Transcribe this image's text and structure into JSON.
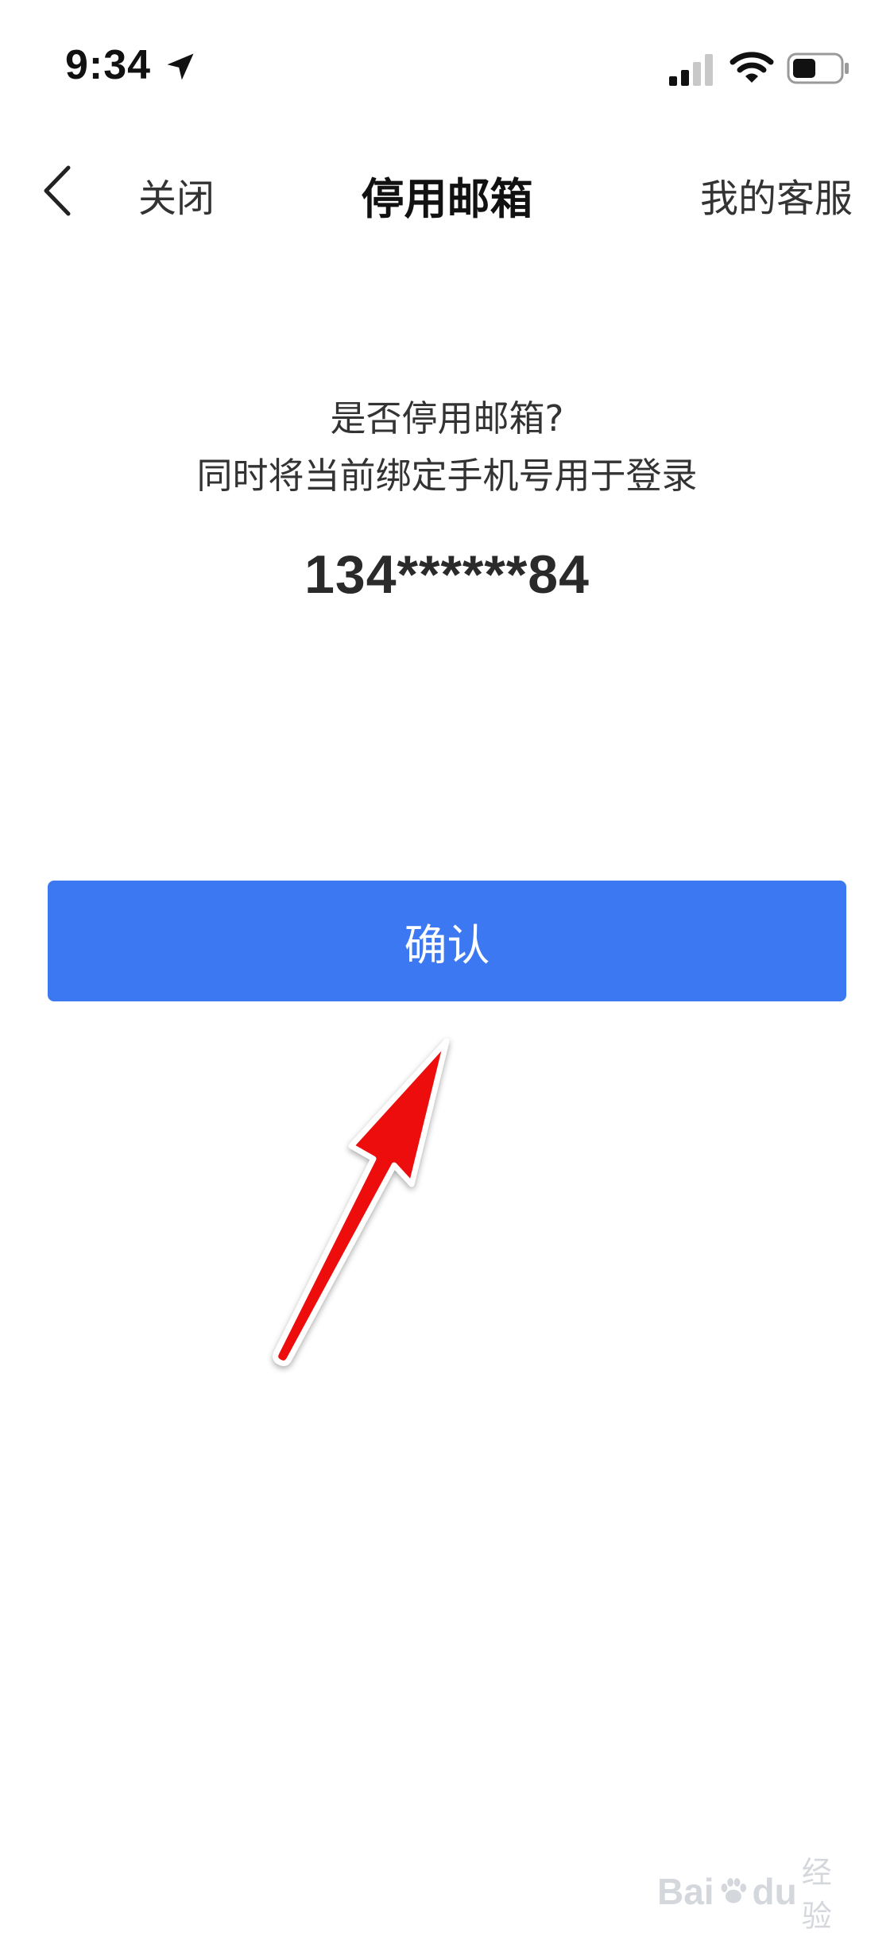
{
  "status_bar": {
    "time": "9:34",
    "icons": [
      "location-arrow-icon",
      "cellular-signal-icon",
      "wifi-icon",
      "battery-icon"
    ]
  },
  "nav": {
    "back_icon": "chevron-left-icon",
    "close_label": "关闭",
    "title": "停用邮箱",
    "service_label": "我的客服"
  },
  "content": {
    "prompt_line_1": "是否停用邮箱?",
    "prompt_line_2": "同时将当前绑定手机号用于登录",
    "phone_number": "134******84"
  },
  "confirm": {
    "label": "确认",
    "color": "#3b78f2"
  },
  "annotation": {
    "icon": "red-arrow-icon",
    "color": "#ee1111"
  },
  "watermark": {
    "brand": "Bai",
    "brand_tail": "du",
    "suffix": "经验",
    "icon": "paw-icon"
  }
}
